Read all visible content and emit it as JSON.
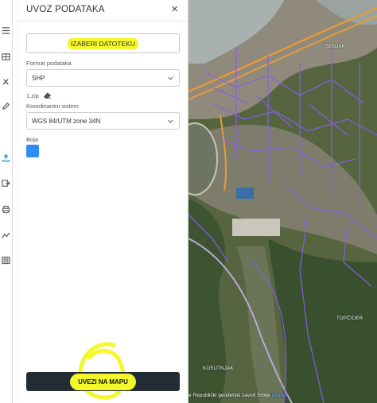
{
  "toolbar": {
    "tools": [
      {
        "icon": "list-icon"
      },
      {
        "icon": "layers-grid-icon"
      },
      {
        "icon": "tools-icon"
      },
      {
        "icon": "pencil-icon"
      },
      {
        "icon": "upload-icon"
      },
      {
        "icon": "export-icon"
      },
      {
        "icon": "print-icon"
      },
      {
        "icon": "measure-icon"
      },
      {
        "icon": "grid-icon"
      }
    ]
  },
  "panel": {
    "title": "UVOZ PODATAKA",
    "close_label": "×",
    "choose_file_label": "IZABERI DATOTEKU",
    "format_label": "Format podataka",
    "format_value": "SHP",
    "file_name": "1.zip",
    "crs_label": "Koordinantni sistem",
    "crs_value": "WGS 84/UTM zone 34N",
    "color_label": "Boja",
    "color_value": "#2f8ef4",
    "upload_label": "UVEZI NA MAPU",
    "highlight_color": "#f4f82a"
  },
  "map": {
    "places": {
      "senjak": "SENJAK",
      "topcider": "TOPČIDER",
      "kosutnjak": "KOŠUTNJAK"
    },
    "attribution_text": "e Republički geodetski zavod Srbije",
    "attribution_link": "Leaflet",
    "overlay_color": "#8a5cf0"
  }
}
